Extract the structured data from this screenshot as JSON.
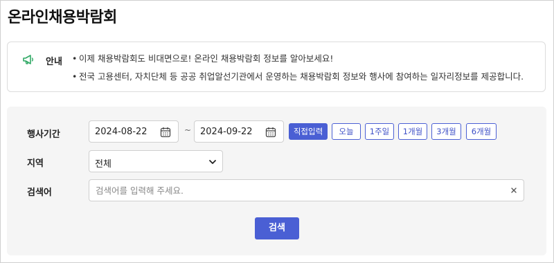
{
  "page": {
    "title": "온라인채용박람회"
  },
  "notice": {
    "icon": "megaphone-icon",
    "title": "안내",
    "lines": [
      "이제 채용박람회도 비대면으로! 온라인 채용박람회 정보를 알아보세요!",
      "전국 고용센터, 자치단체 등 공공 취업알선기관에서 운영하는 채용박람회 정보와 행사에 참여하는 일자리정보를 제공합니다."
    ]
  },
  "search": {
    "period_label": "행사기간",
    "date_from": "2024-08-22",
    "date_to": "2024-09-22",
    "separator": "~",
    "period_buttons": [
      {
        "label": "직접입력",
        "active": true
      },
      {
        "label": "오늘",
        "active": false
      },
      {
        "label": "1주일",
        "active": false
      },
      {
        "label": "1개월",
        "active": false
      },
      {
        "label": "3개월",
        "active": false
      },
      {
        "label": "6개월",
        "active": false
      }
    ],
    "region_label": "지역",
    "region_value": "전체",
    "keyword_label": "검색어",
    "keyword_value": "",
    "keyword_placeholder": "검색어를 입력해 주세요.",
    "submit_label": "검색"
  },
  "colors": {
    "accent": "#4a5fd4",
    "notice_icon": "#2fa864",
    "panel_bg": "#f5f5f5"
  }
}
